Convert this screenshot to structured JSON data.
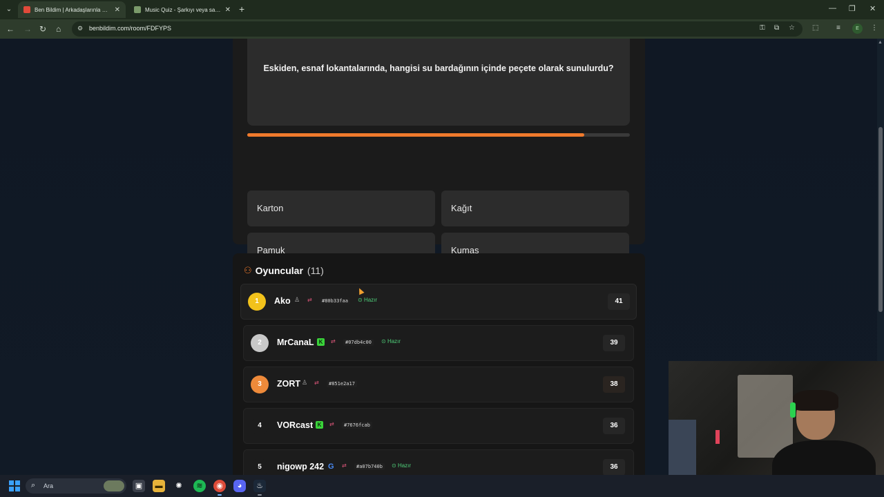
{
  "browser": {
    "tabs": [
      {
        "title": "Ben Bildim | Arkadaşlarınla Onli",
        "active": true
      },
      {
        "title": "Music Quiz - Şarkıyı veya sanat",
        "active": false
      }
    ],
    "url": "benbildim.com/room/FDFYPS",
    "profile_initial": "E"
  },
  "quiz": {
    "question": "Eskiden, esnaf lokantalarında, hangisi su bardağının içinde peçete olarak sunulurdu?",
    "progress": 0.88,
    "answers": [
      "Karton",
      "Kağıt",
      "Pamuk",
      "Kumaş"
    ]
  },
  "players": {
    "title": "Oyuncular",
    "count": "(11)",
    "list": [
      {
        "rank": "1",
        "name": "Ako",
        "code": "#80b33faa",
        "status": "Hazır",
        "score": "41"
      },
      {
        "rank": "2",
        "name": "MrCanaL",
        "code": "#07db4c00",
        "status": "Hazır",
        "score": "39"
      },
      {
        "rank": "3",
        "name": "ZORT",
        "code": "#851e2a17",
        "status": "",
        "score": "38"
      },
      {
        "rank": "4",
        "name": "VORcast",
        "code": "#7676fcab",
        "status": "",
        "score": "36"
      },
      {
        "rank": "5",
        "name": "nigowp 242",
        "code": "#a07b740b",
        "status": "Hazır",
        "score": "36"
      }
    ]
  },
  "taskbar": {
    "search_label": "Ara"
  },
  "colors": {
    "accent": "#f07a2c",
    "ready_green": "#4fd07a",
    "gold": "#f2c21b",
    "silver": "#c8c8c8",
    "bronze": "#ee8a3a"
  }
}
